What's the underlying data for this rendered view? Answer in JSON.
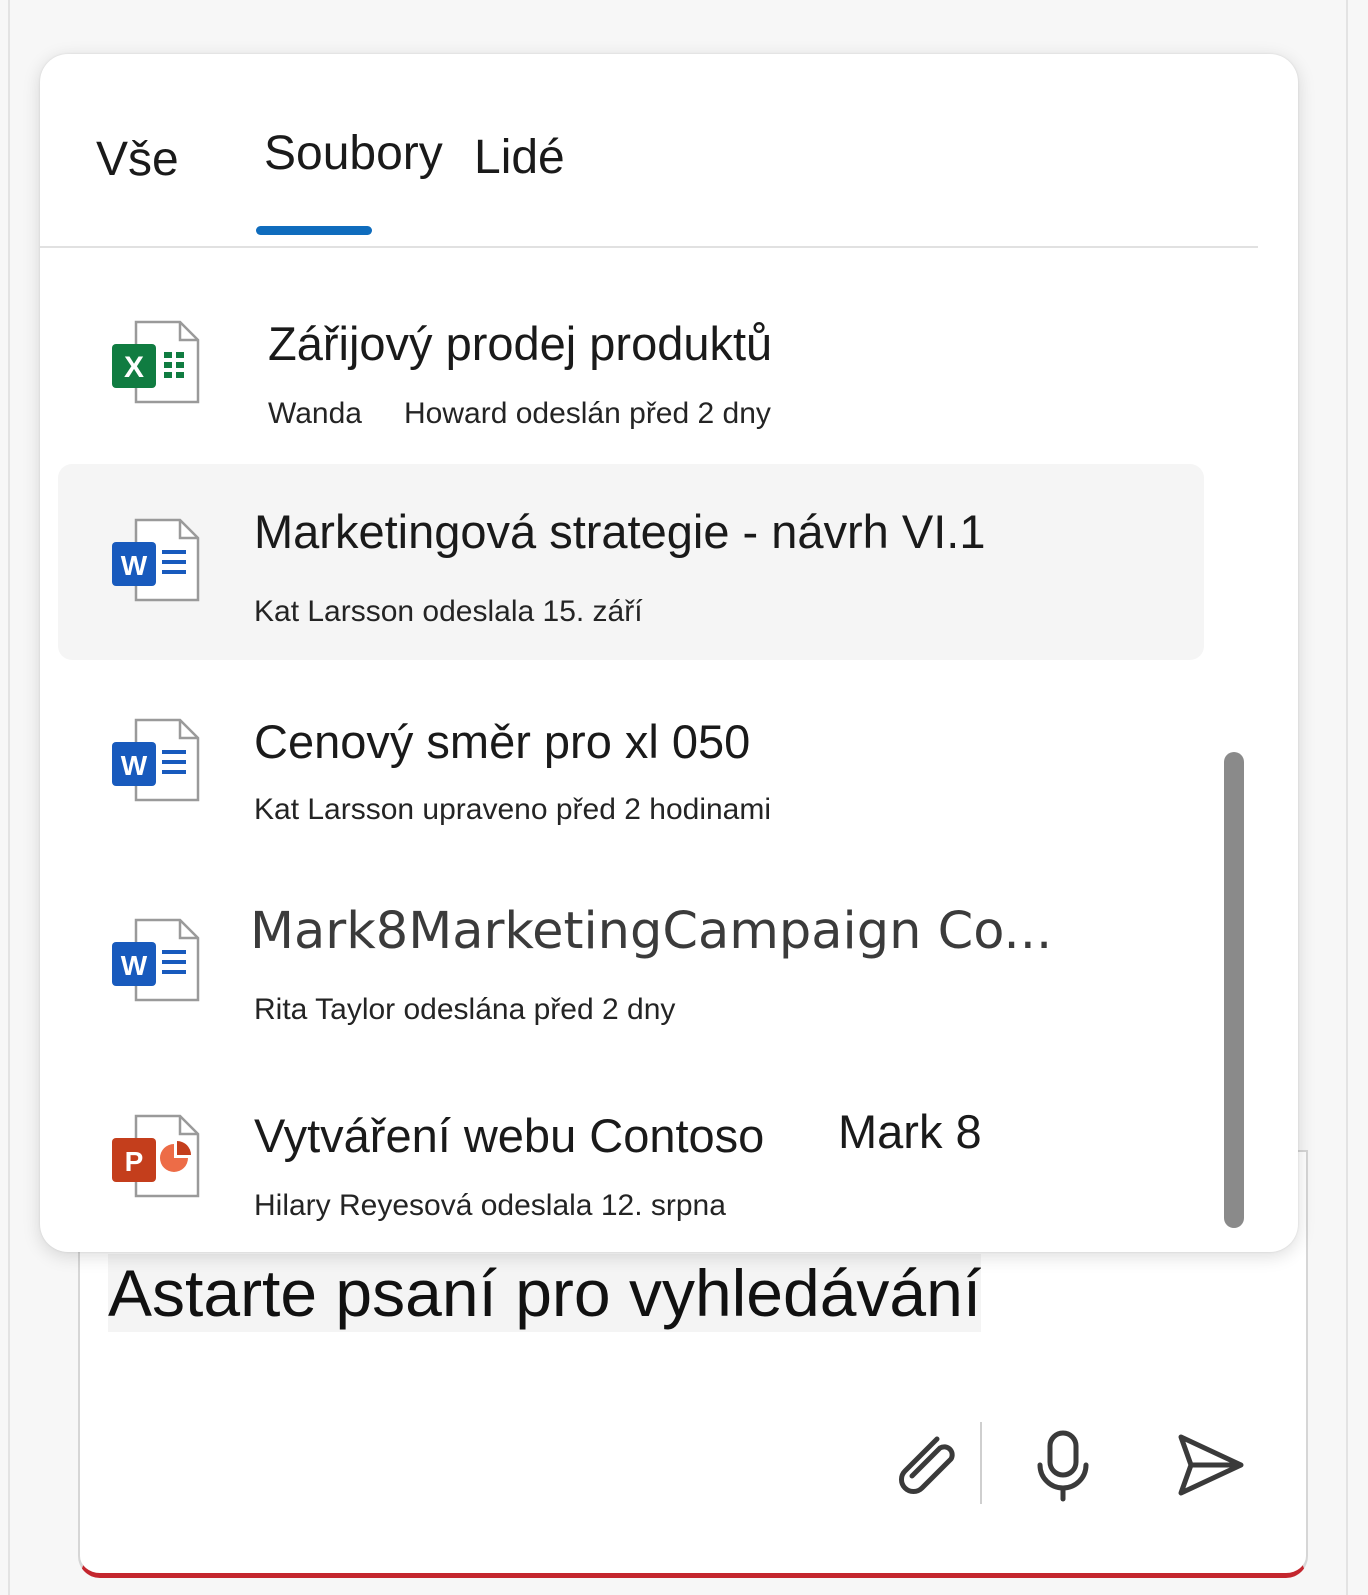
{
  "tabs": [
    {
      "label": "Vše"
    },
    {
      "label": "Soubory"
    },
    {
      "label": "Lidé"
    }
  ],
  "files": [
    {
      "title": "Zářijový prodej produktů",
      "meta_author": "Wanda",
      "meta_detail": "Howard odeslán před 2 dny",
      "icon": "excel-icon"
    },
    {
      "title": "Marketingová strategie - návrh VI.1",
      "meta": "Kat Larsson odeslala 15. září",
      "icon": "word-icon"
    },
    {
      "title": "Cenový směr pro xl 050",
      "meta": "Kat Larsson upraveno před 2 hodinami",
      "icon": "word-icon"
    },
    {
      "title": "Mark8MarketingCampaign Co...",
      "meta": "Rita Taylor odeslána před 2 dny",
      "icon": "word-icon"
    },
    {
      "title": "Vytváření webu Contoso",
      "tag": "Mark 8",
      "meta": "Hilary Reyesová odeslala 12. srpna",
      "icon": "powerpoint-icon"
    }
  ],
  "compose": {
    "text": "Astarte psaní pro vyhledávání"
  },
  "colors": {
    "accent": "#0f6cbd",
    "excel": "#107c41",
    "word": "#185abd",
    "powerpoint": "#c43e1c",
    "compose_border": "#c4262e"
  },
  "icons": {
    "attach": "paperclip-icon",
    "mic": "microphone-icon",
    "send": "send-icon"
  }
}
